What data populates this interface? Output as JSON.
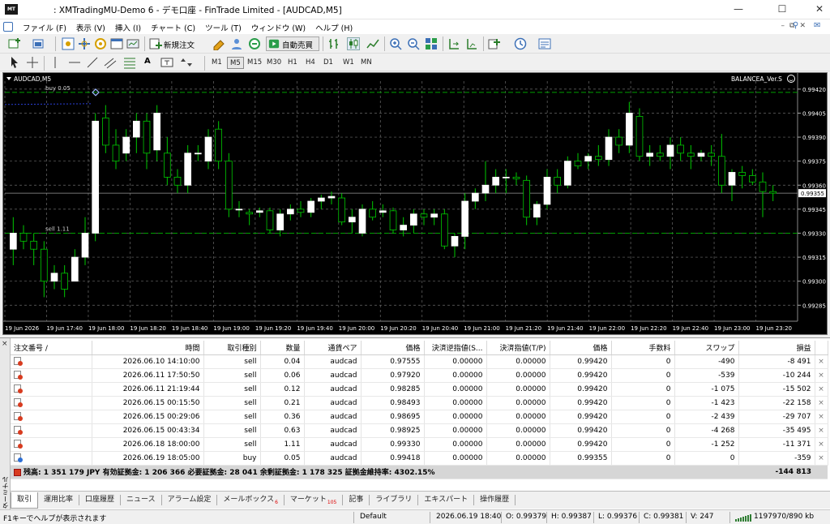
{
  "window": {
    "title": ": XMTradingMU-Demo 6 - デモ口座 - FinTrade Limited - [AUDCAD,M5]",
    "logo_text": "MT"
  },
  "menu": [
    "ファイル (F)",
    "表示 (V)",
    "挿入 (I)",
    "チャート (C)",
    "ツール (T)",
    "ウィンドウ (W)",
    "ヘルプ (H)"
  ],
  "toolbar": {
    "new_order_label": "新規注文",
    "auto_trade_label": "自動売買"
  },
  "timeframes": [
    "M1",
    "M5",
    "M15",
    "M30",
    "H1",
    "H4",
    "D1",
    "W1",
    "MN"
  ],
  "active_timeframe": "M5",
  "chart": {
    "symbol_label": "AUDCAD,M5",
    "ea_label": "BALANCEA_Ver.S",
    "buy_line_label": "buy 0.05",
    "sell_line_label": "sell 1.11",
    "current_price": "0.99355",
    "price_ticks": [
      "0.99420",
      "0.99405",
      "0.99390",
      "0.99375",
      "0.99360",
      "0.99345",
      "0.99330",
      "0.99315",
      "0.99300",
      "0.99285"
    ],
    "time_ticks": [
      "19 Jun 2026",
      "19 Jun 17:40",
      "19 Jun 18:00",
      "19 Jun 18:20",
      "19 Jun 18:40",
      "19 Jun 19:00",
      "19 Jun 19:20",
      "19 Jun 19:40",
      "19 Jun 20:00",
      "19 Jun 20:20",
      "19 Jun 20:40",
      "19 Jun 21:00",
      "19 Jun 21:20",
      "19 Jun 21:40",
      "19 Jun 22:00",
      "19 Jun 22:20",
      "19 Jun 22:40",
      "19 Jun 23:00",
      "19 Jun 23:20"
    ],
    "colors": {
      "bull": "#ffffff",
      "bear": "#000000",
      "wick": "#00c800",
      "grid": "#6a6a6a",
      "level": "#00a000",
      "buy_line": "#2a3fd6",
      "bg": "#000000"
    }
  },
  "chart_data": {
    "type": "candlestick",
    "ylim": [
      0.99275,
      0.99425
    ],
    "price_levels": {
      "buy": 0.99418,
      "sell": 0.9933,
      "current": 0.99355
    },
    "ohlc": [
      [
        0.9932,
        0.9934,
        0.9931,
        0.9933
      ],
      [
        0.9933,
        0.99335,
        0.9932,
        0.99325
      ],
      [
        0.99325,
        0.9933,
        0.9931,
        0.9932
      ],
      [
        0.9932,
        0.99325,
        0.9929,
        0.993
      ],
      [
        0.993,
        0.9931,
        0.99295,
        0.99305
      ],
      [
        0.99305,
        0.9931,
        0.9929,
        0.99295
      ],
      [
        0.993,
        0.9932,
        0.993,
        0.99315
      ],
      [
        0.99315,
        0.9934,
        0.9931,
        0.9933
      ],
      [
        0.9933,
        0.99405,
        0.99325,
        0.994
      ],
      [
        0.99402,
        0.9941,
        0.9938,
        0.99385
      ],
      [
        0.99385,
        0.99395,
        0.9937,
        0.99375
      ],
      [
        0.9938,
        0.99395,
        0.99375,
        0.9939
      ],
      [
        0.9939,
        0.99405,
        0.9938,
        0.994
      ],
      [
        0.994,
        0.99405,
        0.9937,
        0.9938
      ],
      [
        0.99382,
        0.9941,
        0.99375,
        0.99405
      ],
      [
        0.9938,
        0.9939,
        0.9936,
        0.99365
      ],
      [
        0.99365,
        0.9937,
        0.99355,
        0.9936
      ],
      [
        0.9936,
        0.99385,
        0.99355,
        0.9938
      ],
      [
        0.9938,
        0.99385,
        0.99375,
        0.9938
      ],
      [
        0.99375,
        0.99395,
        0.9937,
        0.9939
      ],
      [
        0.99395,
        0.994,
        0.9937,
        0.99375
      ],
      [
        0.99375,
        0.9938,
        0.9934,
        0.99345
      ],
      [
        0.99345,
        0.9935,
        0.9934,
        0.99345
      ],
      [
        0.99343,
        0.99345,
        0.99335,
        0.99342
      ],
      [
        0.99343,
        0.99346,
        0.9934,
        0.99344
      ],
      [
        0.99344,
        0.99346,
        0.9933,
        0.99332
      ],
      [
        0.99332,
        0.99345,
        0.99328,
        0.99342
      ],
      [
        0.99342,
        0.99348,
        0.99338,
        0.99345
      ],
      [
        0.99345,
        0.9935,
        0.9934,
        0.99343
      ],
      [
        0.99343,
        0.99352,
        0.9934,
        0.9935
      ],
      [
        0.9935,
        0.99354,
        0.99345,
        0.99352
      ],
      [
        0.99352,
        0.99356,
        0.99348,
        0.99353
      ],
      [
        0.99352,
        0.99355,
        0.99335,
        0.99337
      ],
      [
        0.99337,
        0.99345,
        0.9933,
        0.9934
      ],
      [
        0.9933,
        0.99348,
        0.99328,
        0.99345
      ],
      [
        0.99345,
        0.9935,
        0.99338,
        0.9934
      ],
      [
        0.99343,
        0.99348,
        0.9934,
        0.99344
      ],
      [
        0.99344,
        0.99346,
        0.9933,
        0.99332
      ],
      [
        0.99332,
        0.9934,
        0.99328,
        0.99335
      ],
      [
        0.99335,
        0.99345,
        0.9933,
        0.99342
      ],
      [
        0.99342,
        0.99345,
        0.99335,
        0.9934
      ],
      [
        0.9934,
        0.99345,
        0.99335,
        0.99342
      ],
      [
        0.99342,
        0.99345,
        0.9932,
        0.99322
      ],
      [
        0.99322,
        0.9933,
        0.99315,
        0.99328
      ],
      [
        0.99328,
        0.99355,
        0.9932,
        0.9935
      ],
      [
        0.9935,
        0.99358,
        0.99345,
        0.99355
      ],
      [
        0.99355,
        0.99375,
        0.9935,
        0.9936
      ],
      [
        0.9936,
        0.9937,
        0.99355,
        0.99365
      ],
      [
        0.99365,
        0.9937,
        0.99355,
        0.99365
      ],
      [
        0.99365,
        0.99368,
        0.9936,
        0.99364
      ],
      [
        0.99363,
        0.99366,
        0.99335,
        0.9934
      ],
      [
        0.9934,
        0.9935,
        0.99335,
        0.99348
      ],
      [
        0.99348,
        0.9937,
        0.99345,
        0.99365
      ],
      [
        0.99365,
        0.9937,
        0.99355,
        0.9936
      ],
      [
        0.9936,
        0.99378,
        0.99358,
        0.99375
      ],
      [
        0.99375,
        0.9938,
        0.9937,
        0.99372
      ],
      [
        0.99375,
        0.9938,
        0.9937,
        0.99378
      ],
      [
        0.99378,
        0.99385,
        0.99372,
        0.99376
      ],
      [
        0.99376,
        0.99395,
        0.99372,
        0.9939
      ],
      [
        0.9939,
        0.99395,
        0.9938,
        0.99385
      ],
      [
        0.99385,
        0.99412,
        0.9938,
        0.99405
      ],
      [
        0.99403,
        0.99408,
        0.99375,
        0.99378
      ],
      [
        0.99378,
        0.99385,
        0.99372,
        0.9938
      ],
      [
        0.9938,
        0.99385,
        0.99375,
        0.99378
      ],
      [
        0.99378,
        0.9939,
        0.9937,
        0.99385
      ],
      [
        0.99385,
        0.9939,
        0.99375,
        0.9938
      ],
      [
        0.9938,
        0.99385,
        0.9937,
        0.99378
      ],
      [
        0.99378,
        0.99382,
        0.99375,
        0.9938
      ],
      [
        0.9938,
        0.99385,
        0.99372,
        0.99378
      ],
      [
        0.99378,
        0.99392,
        0.99355,
        0.9936
      ],
      [
        0.9936,
        0.9937,
        0.9935,
        0.99368
      ],
      [
        0.99368,
        0.99372,
        0.99358,
        0.99366
      ],
      [
        0.99366,
        0.9937,
        0.9936,
        0.99362
      ],
      [
        0.99362,
        0.99368,
        0.9934,
        0.99356
      ],
      [
        0.99356,
        0.9936,
        0.9935,
        0.99355
      ]
    ]
  },
  "orders": {
    "columns": [
      "注文番号",
      "時間",
      "取引種別",
      "数量",
      "通貨ペア",
      "価格",
      "決済逆指値(S...",
      "決済指値(T/P)",
      "価格",
      "手数料",
      "スワップ",
      "損益"
    ],
    "sort_marker": "/",
    "rows": [
      [
        "2026.06.10 14:10:00",
        "sell",
        "0.04",
        "audcad",
        "0.97555",
        "0.00000",
        "0.00000",
        "0.99420",
        "0",
        "-490",
        "-8 491"
      ],
      [
        "2026.06.11 17:50:50",
        "sell",
        "0.06",
        "audcad",
        "0.97920",
        "0.00000",
        "0.00000",
        "0.99420",
        "0",
        "-539",
        "-10 244"
      ],
      [
        "2026.06.11 21:19:44",
        "sell",
        "0.12",
        "audcad",
        "0.98285",
        "0.00000",
        "0.00000",
        "0.99420",
        "0",
        "-1 075",
        "-15 502"
      ],
      [
        "2026.06.15 00:15:50",
        "sell",
        "0.21",
        "audcad",
        "0.98493",
        "0.00000",
        "0.00000",
        "0.99420",
        "0",
        "-1 423",
        "-22 158"
      ],
      [
        "2026.06.15 00:29:06",
        "sell",
        "0.36",
        "audcad",
        "0.98695",
        "0.00000",
        "0.00000",
        "0.99420",
        "0",
        "-2 439",
        "-29 707"
      ],
      [
        "2026.06.15 00:43:34",
        "sell",
        "0.63",
        "audcad",
        "0.98925",
        "0.00000",
        "0.00000",
        "0.99420",
        "0",
        "-4 268",
        "-35 495"
      ],
      [
        "2026.06.18 18:00:00",
        "sell",
        "1.11",
        "audcad",
        "0.99330",
        "0.00000",
        "0.00000",
        "0.99420",
        "0",
        "-1 252",
        "-11 371"
      ],
      [
        "2026.06.19 18:05:00",
        "buy",
        "0.05",
        "audcad",
        "0.99418",
        "0.00000",
        "0.00000",
        "0.99355",
        "0",
        "0",
        "-359"
      ]
    ],
    "close_glyph": "×",
    "summary_text": "残高: 1 351 179 JPY  有効証拠金: 1 206 366  必要証拠金: 28 041  余剰証拠金: 1 178 325  証拠金維持率: 4302.15%",
    "summary_total": "-144 813"
  },
  "terminal": {
    "side_label": "ターミナル",
    "close_glyph": "×",
    "tabs": [
      {
        "label": "取引"
      },
      {
        "label": "運用比率"
      },
      {
        "label": "口座履歴"
      },
      {
        "label": "ニュース"
      },
      {
        "label": "アラーム設定"
      },
      {
        "label": "メールボックス",
        "badge": "6"
      },
      {
        "label": "マーケット",
        "badge": "105"
      },
      {
        "label": "記事"
      },
      {
        "label": "ライブラリ"
      },
      {
        "label": "エキスパート"
      },
      {
        "label": "操作履歴"
      }
    ]
  },
  "status": {
    "help": "F1キーでヘルプが表示されます",
    "profile": "Default",
    "datetime": "2026.06.19 18:40",
    "open": "O: 0.99379",
    "high": "H: 0.99387",
    "low": "L: 0.99376",
    "close": "C: 0.99381",
    "volume": "V: 247",
    "traffic": "1197970/890 kb"
  }
}
